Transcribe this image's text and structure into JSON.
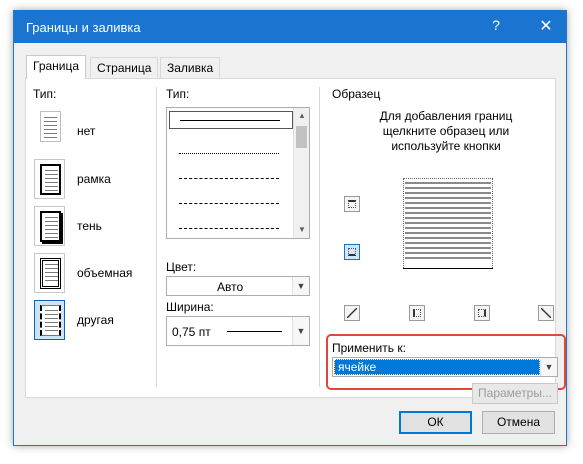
{
  "window": {
    "title": "Границы и заливка",
    "help": "?",
    "close": "✕"
  },
  "tabs": [
    {
      "label": "Граница"
    },
    {
      "label": "Страница"
    },
    {
      "label": "Заливка"
    }
  ],
  "setting": {
    "label": "Тип:",
    "items": [
      {
        "label": "нет"
      },
      {
        "label": "рамка"
      },
      {
        "label": "тень"
      },
      {
        "label": "объемная"
      },
      {
        "label": "другая"
      }
    ]
  },
  "style": {
    "label": "Тип:",
    "color_label": "Цвет:",
    "color_value": "Авто",
    "width_label": "Ширина:",
    "width_value": "0,75 пт"
  },
  "preview": {
    "label": "Образец",
    "hint_line1": "Для добавления границ",
    "hint_line2": "щелкните образец или",
    "hint_line3": "используйте кнопки"
  },
  "apply": {
    "label": "Применить к:",
    "value": "ячейке",
    "options_button": "Параметры..."
  },
  "footer": {
    "ok": "ОК",
    "cancel": "Отмена"
  },
  "colors": {
    "titlebar": "#1b75d0",
    "highlight": "#0078d7",
    "annotation": "#e0463a"
  }
}
